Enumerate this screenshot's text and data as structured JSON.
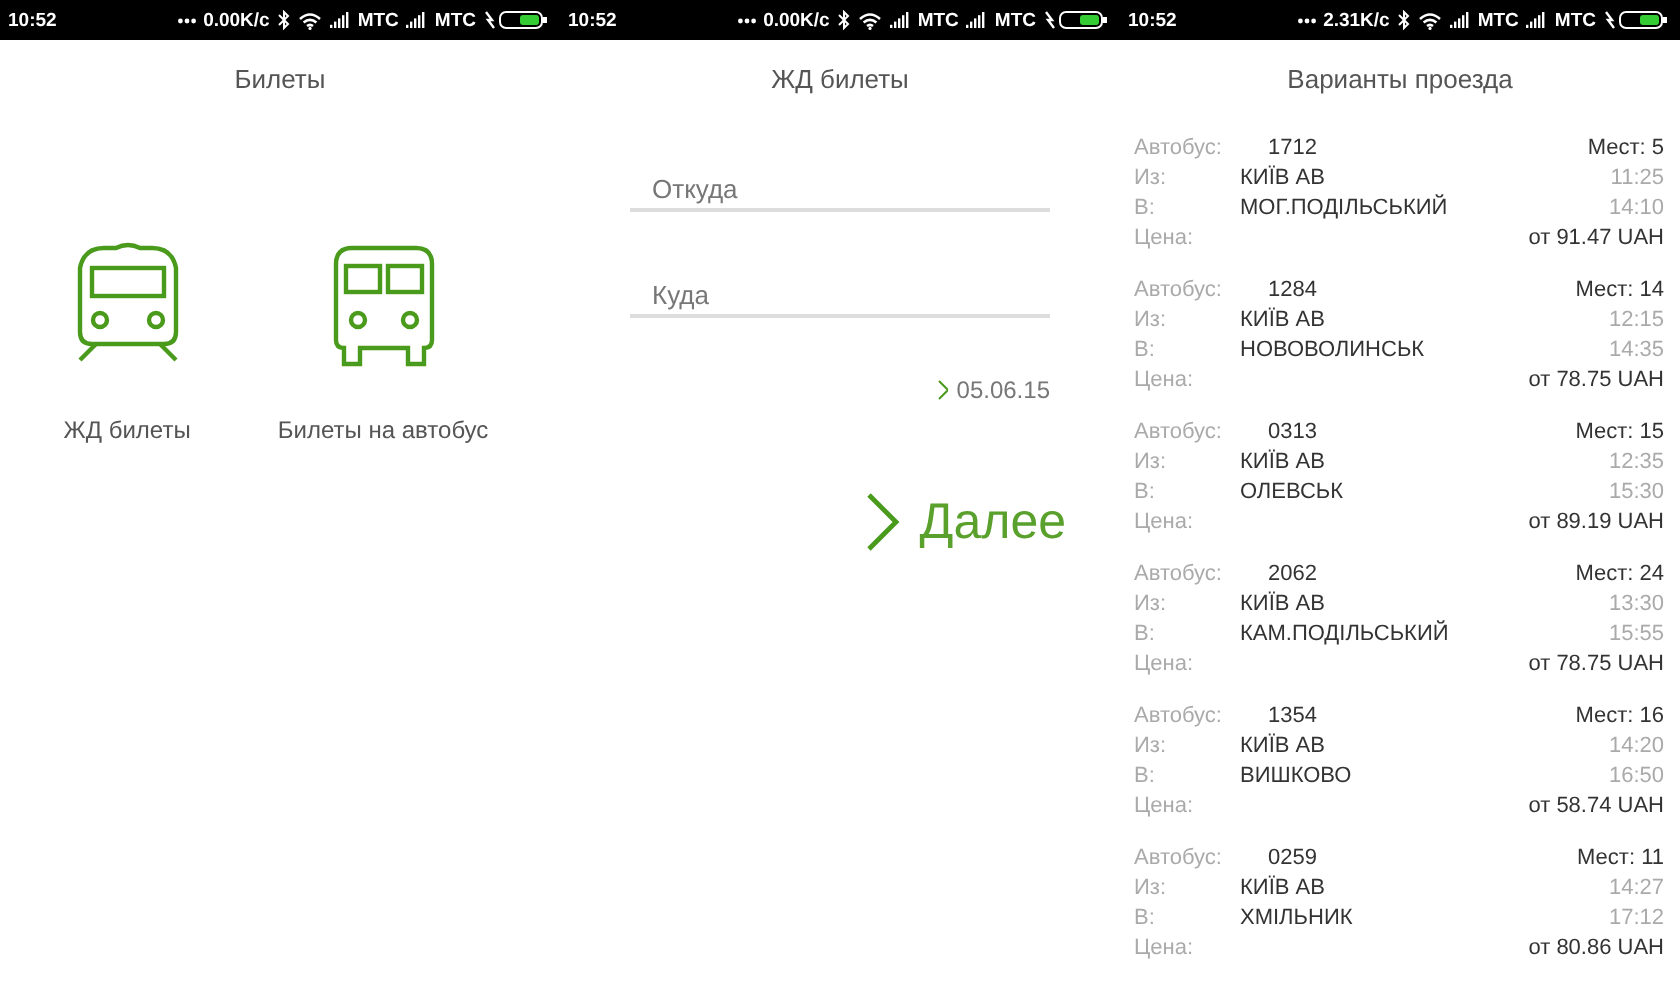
{
  "screens": [
    {
      "status_bar": {
        "time": "10:52",
        "speed": "0.00K/c",
        "carriers": [
          "МТС",
          "МТС"
        ]
      },
      "title": "Билеты",
      "kind": "menu",
      "options": [
        {
          "kind": "train",
          "label": "ЖД билеты"
        },
        {
          "kind": "bus",
          "label": "Билеты на автобус"
        }
      ]
    },
    {
      "status_bar": {
        "time": "10:52",
        "speed": "0.00K/c",
        "carriers": [
          "МТС",
          "МТС"
        ]
      },
      "title": "ЖД билеты",
      "kind": "form",
      "fields": [
        {
          "placeholder": "Откуда"
        },
        {
          "placeholder": "Куда"
        }
      ],
      "date": "05.06.15",
      "next_button": "Далее"
    },
    {
      "status_bar": {
        "time": "10:52",
        "speed": "2.31K/c",
        "carriers": [
          "МТС",
          "МТС"
        ]
      },
      "title": "Варианты проезда",
      "kind": "list",
      "trips": [
        {
          "bus_label": "Автобус:",
          "bus": "1712",
          "seats": "Мест: 5",
          "from_label": "Из:",
          "from": "КИЇВ АВ",
          "depart": "11:25",
          "to_label": "В:",
          "to": "МОГ.ПОДІЛЬСЬКИЙ",
          "arrive": "14:10",
          "price_label": "Цена:",
          "price": "от 91.47 UAH"
        },
        {
          "bus_label": "Автобус:",
          "bus": "1284",
          "seats": "Мест: 14",
          "from_label": "Из:",
          "from": "КИЇВ АВ",
          "depart": "12:15",
          "to_label": "В:",
          "to": "НОВОВОЛИНСЬК",
          "arrive": "14:35",
          "price_label": "Цена:",
          "price": "от 78.75 UAH"
        },
        {
          "bus_label": "Автобус:",
          "bus": "0313",
          "seats": "Мест: 15",
          "from_label": "Из:",
          "from": "КИЇВ АВ",
          "depart": "12:35",
          "to_label": "В:",
          "to": "ОЛЕВСЬК",
          "arrive": "15:30",
          "price_label": "Цена:",
          "price": "от 89.19 UAH"
        },
        {
          "bus_label": "Автобус:",
          "bus": "2062",
          "seats": "Мест: 24",
          "from_label": "Из:",
          "from": "КИЇВ АВ",
          "depart": "13:30",
          "to_label": "В:",
          "to": "КАМ.ПОДІЛЬСЬКИЙ",
          "arrive": "15:55",
          "price_label": "Цена:",
          "price": "от 78.75 UAH"
        },
        {
          "bus_label": "Автобус:",
          "bus": "1354",
          "seats": "Мест: 16",
          "from_label": "Из:",
          "from": "КИЇВ АВ",
          "depart": "14:20",
          "to_label": "В:",
          "to": "ВИШКОВО",
          "arrive": "16:50",
          "price_label": "Цена:",
          "price": "от 58.74 UAH"
        },
        {
          "bus_label": "Автобус:",
          "bus": "0259",
          "seats": "Мест: 11",
          "from_label": "Из:",
          "from": "КИЇВ АВ",
          "depart": "14:27",
          "to_label": "В:",
          "to": "ХМІЛЬНИК",
          "arrive": "17:12",
          "price_label": "Цена:",
          "price": "от 80.86 UAH"
        }
      ]
    }
  ]
}
